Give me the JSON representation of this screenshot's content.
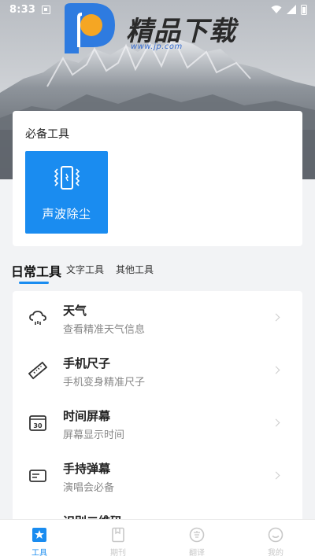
{
  "status_bar": {
    "time": "8:33"
  },
  "watermark": {
    "brand": "精品下载",
    "url": "www.jp.com"
  },
  "essential": {
    "title": "必备工具",
    "tiles": [
      {
        "label": "声波除尘",
        "icon": "phone-vibrate-icon"
      }
    ]
  },
  "tabs": [
    {
      "label": "日常工具",
      "active": true
    },
    {
      "label": "文字工具",
      "active": false
    },
    {
      "label": "其他工具",
      "active": false
    }
  ],
  "list": [
    {
      "title": "天气",
      "subtitle": "查看精准天气信息",
      "icon": "weather-icon"
    },
    {
      "title": "手机尺子",
      "subtitle": "手机变身精准尺子",
      "icon": "ruler-icon"
    },
    {
      "title": "时间屏幕",
      "subtitle": "屏幕显示时间",
      "icon": "clock-screen-icon"
    },
    {
      "title": "手持弹幕",
      "subtitle": "演唱会必备",
      "icon": "barrage-icon"
    },
    {
      "title": "识别二维码",
      "subtitle": "",
      "icon": "qrcode-icon"
    }
  ],
  "bottom_nav": [
    {
      "label": "工具",
      "icon": "tools-icon",
      "active": true
    },
    {
      "label": "期刊",
      "icon": "journal-icon",
      "active": false
    },
    {
      "label": "翻译",
      "icon": "translate-icon",
      "active": false
    },
    {
      "label": "我的",
      "icon": "profile-icon",
      "active": false
    }
  ],
  "colors": {
    "accent": "#1a8cf0",
    "inactive": "#c8c8c8"
  }
}
